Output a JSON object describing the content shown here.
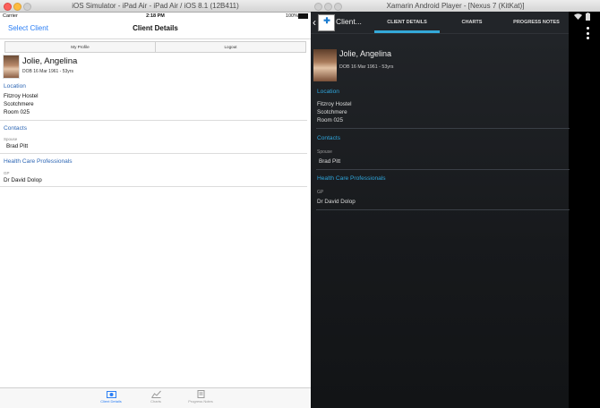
{
  "ios_window": {
    "title": "iOS Simulator - iPad Air - iPad Air / iOS 8.1 (12B411)",
    "status": {
      "carrier": "Carrier",
      "time": "2:18 PM",
      "battery": "100%"
    },
    "nav": {
      "back_label": "Select Client",
      "title": "Client Details"
    },
    "segments": [
      "My Profile",
      "Logout"
    ],
    "client": {
      "name": "Jolie, Angelina",
      "dob": "DOB 16 Mar 1961 - 53yrs"
    },
    "location": {
      "heading": "Location",
      "lines": [
        "Fitzroy Hostel",
        "Scotchmere",
        "Room 025"
      ]
    },
    "contacts": {
      "heading": "Contacts",
      "label": "Spouse",
      "value": "Brad Pitt"
    },
    "hcp": {
      "heading": "Health Care Professionals",
      "label": "GP",
      "value": "Dr David Dolop"
    },
    "tabs": [
      "Client Details",
      "Charts",
      "Progress Notes"
    ],
    "colors": {
      "accent": "#2a7ef5",
      "section": "#2d66b4"
    }
  },
  "android_window": {
    "title": "Xamarin Android Player - [Nexus 7 (KitKat)]",
    "nav": {
      "title": "Client...",
      "tabs": [
        "CLIENT DETAILS",
        "CHARTS",
        "PROGRESS NOTES"
      ]
    },
    "status": {
      "wifi_icon": "wifi-icon",
      "battery_icon": "battery-icon"
    },
    "client": {
      "name": "Jolie, Angelina",
      "dob": "DOB 16 Mar 1961 - 53yrs"
    },
    "location": {
      "heading": "Location",
      "lines": [
        "Fitzroy Hostel",
        "Scotchmere",
        "Room 025"
      ]
    },
    "contacts": {
      "heading": "Contacts",
      "label": "Spouse",
      "value": "Brad Pitt"
    },
    "hcp": {
      "heading": "Health Care Professionals",
      "label": "GP",
      "value": "Dr David Dolop"
    },
    "colors": {
      "accent": "#34a9d9"
    }
  }
}
